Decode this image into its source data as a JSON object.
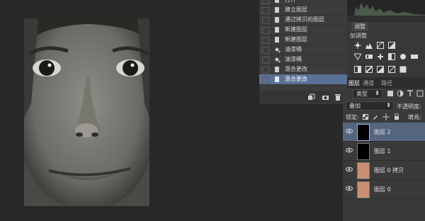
{
  "history": {
    "items": [
      {
        "label": "打开",
        "icon": "document-icon",
        "state": "partial"
      },
      {
        "label": "建立图层",
        "icon": "document-icon"
      },
      {
        "label": "通过拷贝的图层",
        "icon": "document-icon"
      },
      {
        "label": "新建图层",
        "icon": "document-icon"
      },
      {
        "label": "新建图层",
        "icon": "document-icon"
      },
      {
        "label": "油漆桶",
        "icon": "paint-bucket-icon"
      },
      {
        "label": "油漆桶",
        "icon": "paint-bucket-icon"
      },
      {
        "label": "混合更改",
        "icon": "document-icon"
      },
      {
        "label": "混合更改",
        "icon": "document-icon",
        "active": true
      }
    ],
    "toolbar_icons": [
      "new-document-from-state-icon",
      "snapshot-camera-icon",
      "trash-icon"
    ]
  },
  "adjustments": {
    "tab_label": "调整",
    "add_label": "加调整"
  },
  "layers": {
    "tabs": [
      "图层",
      "通道",
      "路径"
    ],
    "kind_filter": "类型",
    "blend_mode": "叠加",
    "opacity_label": "不透明度:",
    "lock_label": "锁定:",
    "fill_label": "填充:",
    "rows": [
      {
        "name": "图层 2",
        "thumb": "black",
        "selected": true
      },
      {
        "name": "图层 1",
        "thumb": "black"
      },
      {
        "name": "图层 0 拷贝",
        "thumb": "skin"
      },
      {
        "name": "图层 0",
        "thumb": "skin"
      }
    ]
  },
  "colors": {
    "workspace": "#282828",
    "panel": "#3c3c3c",
    "history_active": "#5a7196",
    "layer_selected": "#55657f",
    "skin": "#c98f74"
  }
}
